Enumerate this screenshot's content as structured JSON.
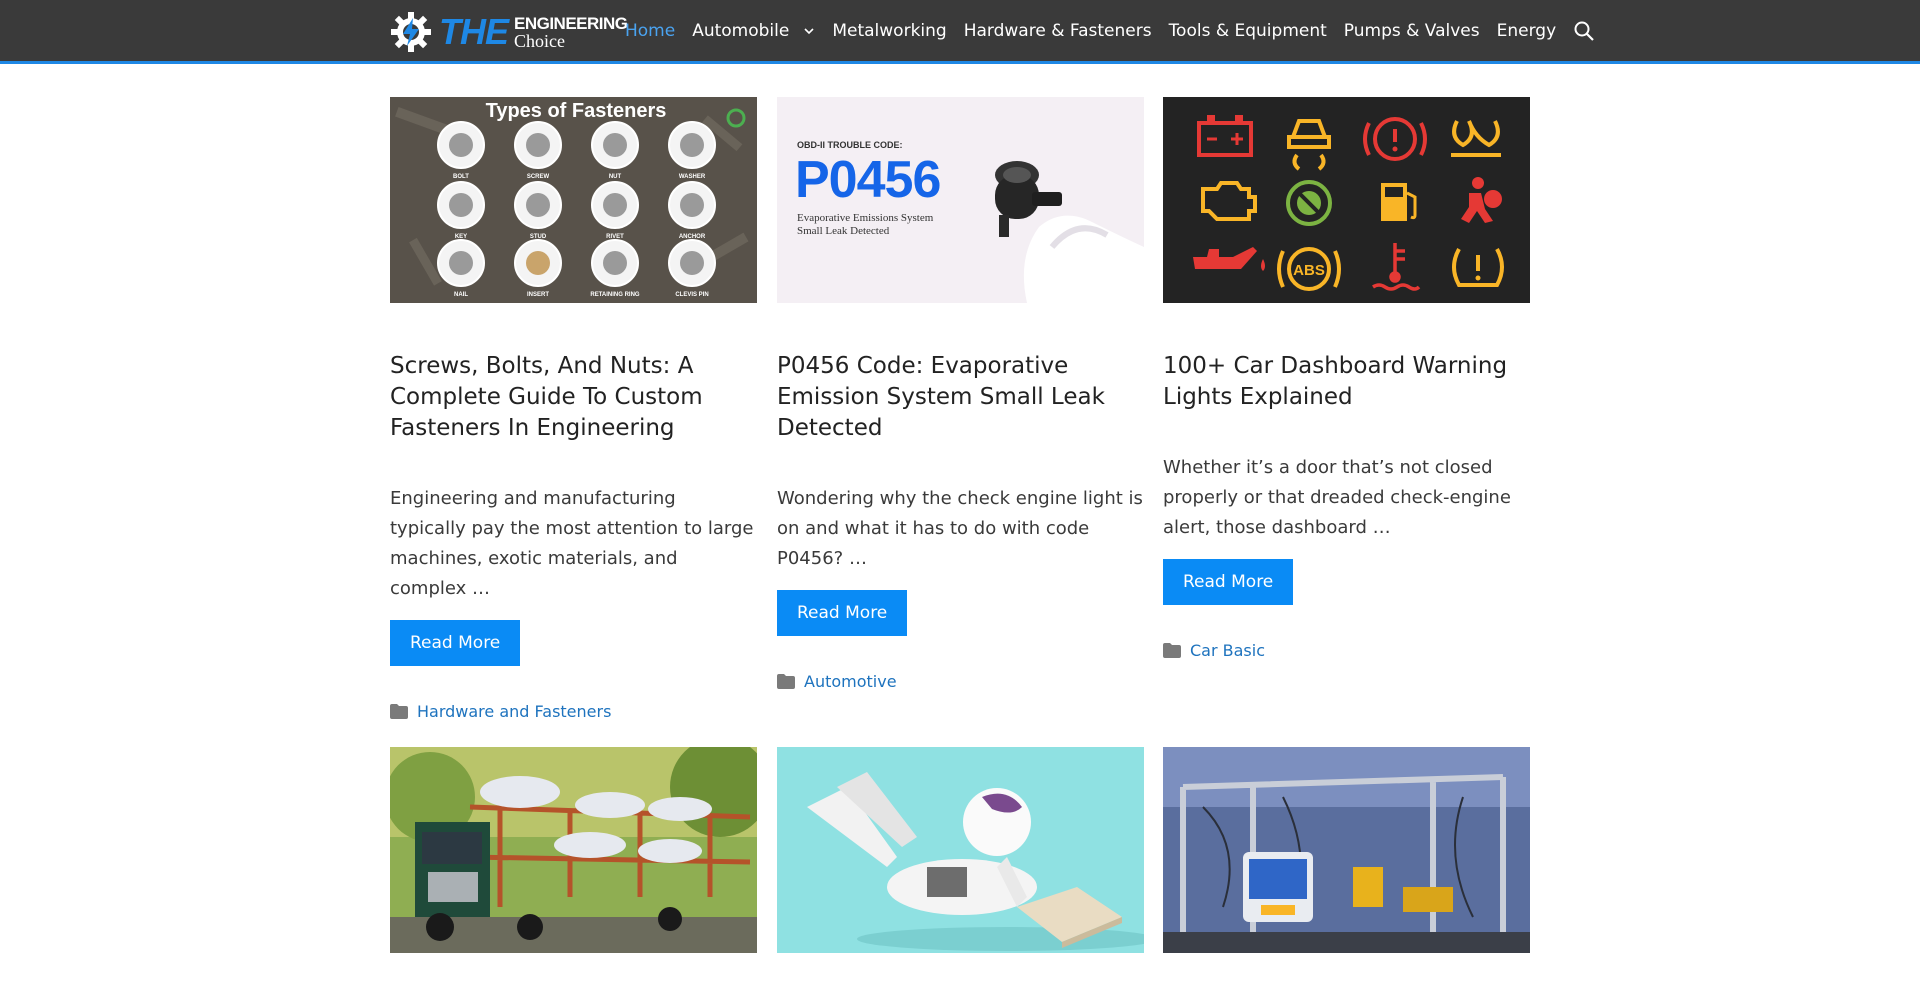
{
  "brand": {
    "the": "THE",
    "engineering": "ENGINEERING",
    "choice": "Choice",
    "accent": "#1e88e5"
  },
  "nav": {
    "items": [
      {
        "label": "Home",
        "active": true
      },
      {
        "label": "Automobile",
        "has_dropdown": true
      },
      {
        "label": "Metalworking"
      },
      {
        "label": "Hardware & Fasteners"
      },
      {
        "label": "Tools & Equipment"
      },
      {
        "label": "Pumps & Valves"
      },
      {
        "label": "Energy"
      }
    ],
    "search_icon": "search-icon"
  },
  "posts": [
    {
      "image": {
        "heading": "Types of Fasteners",
        "labels": [
          "BOLT",
          "SCREW",
          "NUT",
          "WASHER",
          "KEY",
          "STUD",
          "RIVET",
          "ANCHOR",
          "NAIL",
          "INSERT",
          "RETAINING RING",
          "CLEVIS PIN"
        ]
      },
      "title": "Screws, Bolts, And Nuts: A Complete Guide To Custom Fasteners In Engineering",
      "excerpt": "Engineering and manufacturing typically pay the most attention to large machines, exotic materials, and complex …",
      "button": "Read More",
      "category": "Hardware and Fasteners"
    },
    {
      "image": {
        "kicker": "OBD-II TROUBLE CODE:",
        "code": "P0456",
        "sub1": "Evaporative Emissions System",
        "sub2": "Small Leak Detected"
      },
      "title": "P0456 Code: Evaporative Emission System Small Leak Detected",
      "excerpt": "Wondering why the check engine light is on and what it has to do with code P0456? …",
      "button": "Read More",
      "category": "Automotive"
    },
    {
      "image": {
        "abs_label": "ABS"
      },
      "title": "100+ Car Dashboard Warning Lights Explained",
      "excerpt": "Whether it’s a door that’s not closed properly or that dreaded check-engine alert, those dashboard …",
      "button": "Read More",
      "category": "Car Basic"
    }
  ],
  "colors": {
    "header_bg": "#3a3a3a",
    "link": "#1e73be",
    "button": "#0a8bf5"
  }
}
